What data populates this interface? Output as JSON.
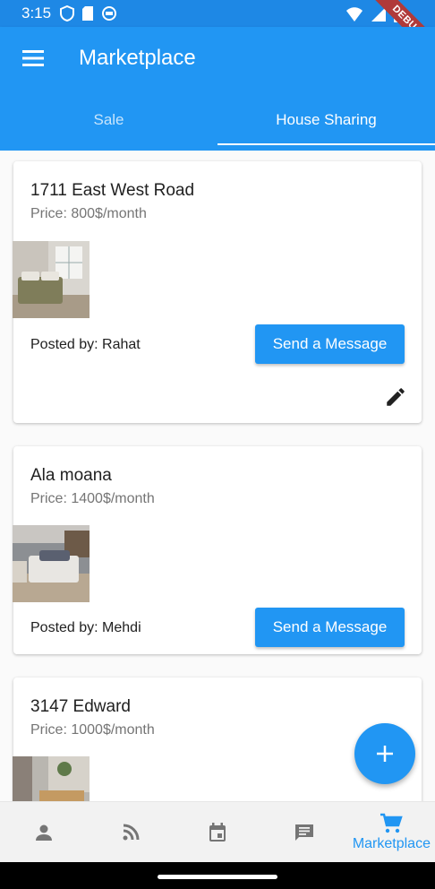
{
  "status_bar": {
    "time": "3:15",
    "debug_banner": "DEBUG"
  },
  "app_bar": {
    "title": "Marketplace",
    "menu_icon": "menu-icon"
  },
  "tabs": [
    {
      "label": "Sale",
      "active": false
    },
    {
      "label": "House Sharing",
      "active": true
    }
  ],
  "listings": [
    {
      "address": "1711 East West Road",
      "price": "Price: 800$/month",
      "posted_by": "Posted by: Rahat",
      "button": "Send a Message",
      "editable": true
    },
    {
      "address": "Ala moana",
      "price": "Price: 1400$/month",
      "posted_by": "Posted by: Mehdi",
      "button": "Send a Message",
      "editable": false
    },
    {
      "address": "3147 Edward",
      "price": "Price: 1000$/month"
    }
  ],
  "fab": {
    "icon": "add-icon"
  },
  "bottom_nav": [
    {
      "icon": "person-icon",
      "label": ""
    },
    {
      "icon": "rss-feed-icon",
      "label": ""
    },
    {
      "icon": "calendar-icon",
      "label": ""
    },
    {
      "icon": "message-icon",
      "label": ""
    },
    {
      "icon": "shopping-cart-icon",
      "label": "Marketplace",
      "active": true
    }
  ],
  "colors": {
    "primary": "#2196f3",
    "status_bar": "#1e88e5",
    "inactive_icon": "#757575",
    "debug_banner": "#b03a3a"
  }
}
